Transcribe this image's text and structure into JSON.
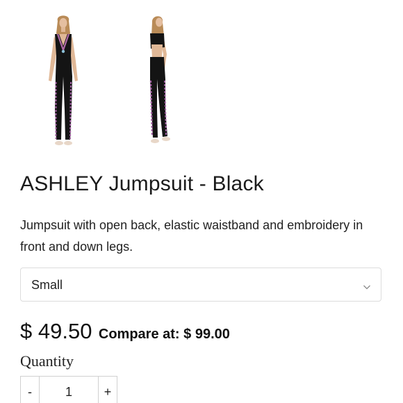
{
  "product": {
    "images": [
      {
        "name": "front-view"
      },
      {
        "name": "back-view"
      }
    ],
    "title": "ASHLEY Jumpsuit - Black",
    "description": "Jumpsuit with open back, elastic waistband and embroidery in front and down legs.",
    "size_select": {
      "selected": "Small",
      "icon": "chevron-down-icon"
    },
    "price": "$ 49.50",
    "compare_label": "Compare at: $ 99.00",
    "quantity": {
      "label": "Quantity",
      "minus_label": "-",
      "value": "1",
      "plus_label": "+"
    }
  }
}
